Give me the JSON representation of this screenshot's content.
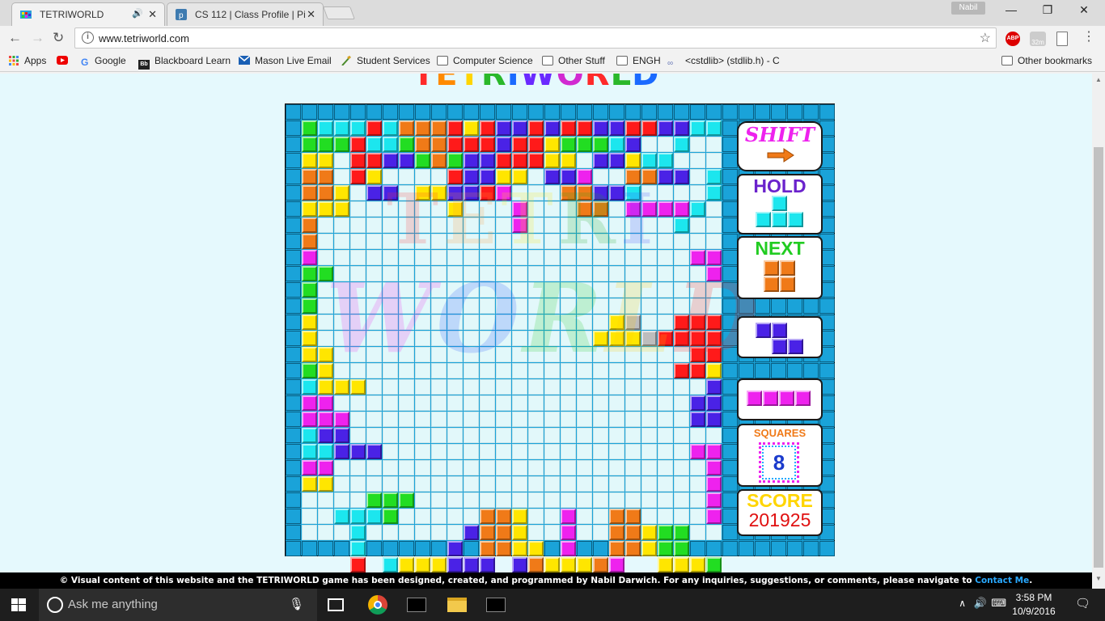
{
  "browser": {
    "tabs": [
      {
        "title": "TETRIWORLD",
        "active": true,
        "audio": true
      },
      {
        "title": "CS 112 | Class Profile | Pi",
        "active": false
      }
    ],
    "profile_name": "Nabil",
    "url": "www.tetriworld.com",
    "extensions": [
      "ABP",
      "32m"
    ],
    "bookmarks": [
      {
        "label": "Apps",
        "icon": "apps-grid-icon"
      },
      {
        "label": "",
        "icon": "youtube-icon"
      },
      {
        "label": "Google",
        "icon": "google-icon"
      },
      {
        "label": "Blackboard Learn",
        "icon": "blackboard-icon"
      },
      {
        "label": "Mason Live Email",
        "icon": "mail-icon"
      },
      {
        "label": "Student Services",
        "icon": "quill-icon"
      },
      {
        "label": "Computer Science",
        "icon": "folder-icon"
      },
      {
        "label": "Other Stuff",
        "icon": "folder-icon"
      },
      {
        "label": "ENGH",
        "icon": "folder-icon"
      },
      {
        "label": "<cstdlib> (stdlib.h) - C",
        "icon": "cplusplus-icon"
      }
    ],
    "other_bookmarks": "Other bookmarks"
  },
  "game": {
    "logo_text": "TETRIWORLD",
    "logo_colors": [
      "#ff2a2a",
      "#ff8a00",
      "#ffd500",
      "#2ab82a",
      "#1a6aff",
      "#6a2aff",
      "#d12ad1",
      "#ff2a2a",
      "#2ab82a",
      "#1a6aff"
    ],
    "watermark_top": "TETRI",
    "watermark_bottom": "WORLD",
    "shift_label": "SHIFT",
    "hold_label": "HOLD",
    "next_label": "NEXT",
    "squares_label": "SQUARES",
    "squares_value": "8",
    "score_label": "SCORE",
    "score_value": "201925",
    "colors": {
      "R": "#ff1a1a",
      "O": "#f07a18",
      "Y": "#ffe600",
      "G": "#22dd22",
      "C": "#1ce6ee",
      "B": "#4a22e6",
      "M": "#ee22ee",
      "S": "#bdbdbd"
    },
    "board": [
      "GCCCRCOOORYRBBRBRRBBRRBBCC",
      "GGGRCCGOORRRBRRYGGGCB..C",
      "YY.RRBBGOGBBRRRYY.BBYCC...",
      "OO.RY....RBBYY.BBM..OOBB.C.",
      "OOY.BB.YYBBRM...OOBBC....C",
      "YYY......Y...M...OO.MMMMC",
      "O............M.........C",
      "O..........................MM",
      "M.......................MMMMM",
      "GG.......................MMM",
      "G.........................MM",
      "G.........................GG",
      "Y..................YS..RRR",
      "Y.................YYYSRRRRR",
      "YY......................RRR",
      "GY.....................RRYY",
      "CYYY.....................BOO",
      "MM......................BBOO",
      "MMM.....................BBBBR",
      "CBB.......................BB",
      "CCBBB...................MMMMM",
      "MM.......................M.C",
      "YY.......................M",
      "....GGG..................M",
      "..CCCG.....OOY..M..OO....MOO",
      "...C......BOOY..M..OOYGG..OO",
      "...C.....B.OOYY.M..OOYGG..RR",
      "...R.CYYYBBB.BOYYYOM..YYYGG..RR"
    ],
    "hold_piece": ".C.,CCC",
    "hold_color": "C",
    "next_piece": "OO,OO",
    "next_color": "O",
    "queue": [
      {
        "shape": "BB.,.BB",
        "color": "B"
      },
      {
        "shape": "MMMM",
        "color": "M"
      }
    ]
  },
  "footer": {
    "text": "© Visual content of this website and the TETRIWORLD game has been designed, created, and programmed by Nabil Darwich. For any inquiries, suggestions, or comments, please navigate to ",
    "link": "Contact Me",
    "end": "."
  },
  "taskbar": {
    "search_placeholder": "Ask me anything",
    "time": "3:58 PM",
    "date": "10/9/2016"
  }
}
